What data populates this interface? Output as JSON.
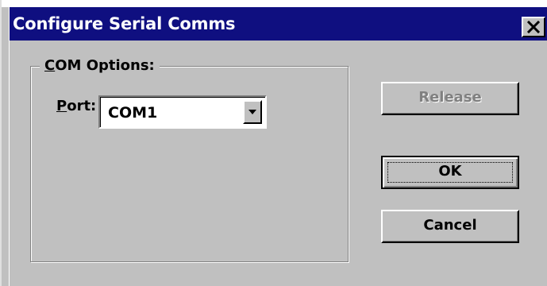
{
  "window": {
    "title": "Configure Serial Comms",
    "close_glyph": "×"
  },
  "com_options": {
    "group_label": "COM Options:",
    "port_label": "Port:",
    "port_value": "COM1"
  },
  "buttons": {
    "release": "Release",
    "ok": "OK",
    "cancel": "Cancel"
  },
  "colors": {
    "title_bar": "#0f0f80",
    "dialog_face": "#c0c0c0",
    "disabled_text": "#808080"
  },
  "icons": {
    "close": "close-icon",
    "dropdown": "chevron-down-icon"
  }
}
